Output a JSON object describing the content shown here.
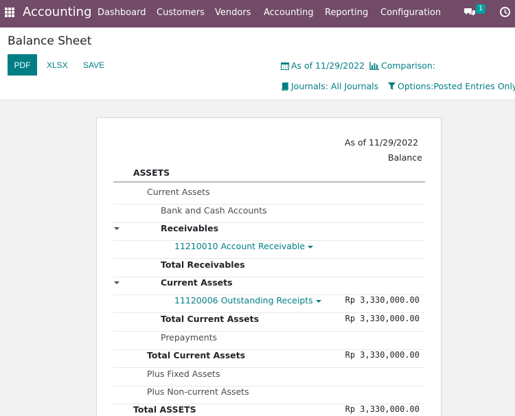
{
  "navbar": {
    "brand": "Accounting",
    "menu": [
      "Dashboard",
      "Customers",
      "Vendors",
      "Accounting",
      "Reporting",
      "Configuration"
    ],
    "chat_count": "1"
  },
  "control": {
    "title": "Balance Sheet",
    "buttons": {
      "pdf": "PDF",
      "xlsx": "XLSX",
      "save": "SAVE"
    },
    "filters": {
      "as_of": "As of 11/29/2022",
      "comparison": "Comparison:",
      "journals": "Journals: All Journals",
      "options": "Options:Posted Entries Only"
    }
  },
  "report": {
    "header_date": "As of 11/29/2022",
    "header_balance": "Balance",
    "rows": [
      {
        "label": "ASSETS",
        "amount": ""
      },
      {
        "label": "Current Assets",
        "amount": ""
      },
      {
        "label": "Bank and Cash Accounts",
        "amount": ""
      },
      {
        "label": "Receivables",
        "amount": ""
      },
      {
        "label": "11210010 Account Receivable",
        "amount": ""
      },
      {
        "label": "Total Receivables",
        "amount": ""
      },
      {
        "label": "Current Assets",
        "amount": ""
      },
      {
        "label": "11120006 Outstanding Receipts",
        "amount": "Rp 3,330,000.00"
      },
      {
        "label": "Total Current Assets",
        "amount": "Rp 3,330,000.00"
      },
      {
        "label": "Prepayments",
        "amount": ""
      },
      {
        "label": "Total Current Assets",
        "amount": "Rp 3,330,000.00"
      },
      {
        "label": "Plus Fixed Assets",
        "amount": ""
      },
      {
        "label": "Plus Non-current Assets",
        "amount": ""
      },
      {
        "label": "Total ASSETS",
        "amount": "Rp 3,330,000.00"
      }
    ]
  },
  "colors": {
    "navbar": "#714b67",
    "accent": "#017e84"
  }
}
